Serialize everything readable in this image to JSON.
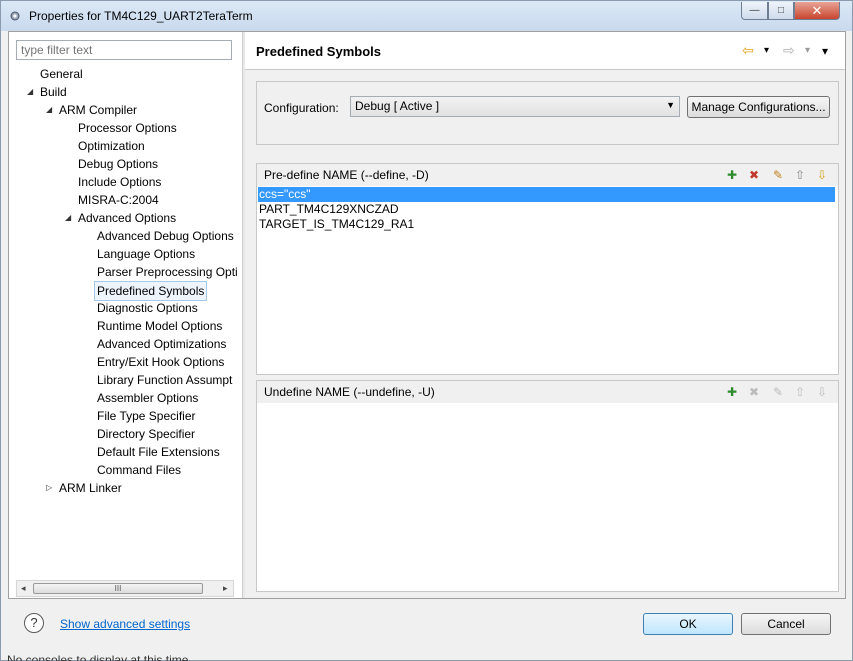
{
  "window": {
    "title": "Properties for TM4C129_UART2TeraTerm",
    "minimize": "—",
    "maximize": "□",
    "close": "✕"
  },
  "filter": {
    "placeholder": "type filter text"
  },
  "tree": [
    {
      "label": "General",
      "depth": 0,
      "twisty": ""
    },
    {
      "label": "Build",
      "depth": 0,
      "twisty": "◢"
    },
    {
      "label": "ARM Compiler",
      "depth": 1,
      "twisty": "◢"
    },
    {
      "label": "Processor Options",
      "depth": 2,
      "twisty": ""
    },
    {
      "label": "Optimization",
      "depth": 2,
      "twisty": ""
    },
    {
      "label": "Debug Options",
      "depth": 2,
      "twisty": ""
    },
    {
      "label": "Include Options",
      "depth": 2,
      "twisty": ""
    },
    {
      "label": "MISRA-C:2004",
      "depth": 2,
      "twisty": ""
    },
    {
      "label": "Advanced Options",
      "depth": 2,
      "twisty": "◢"
    },
    {
      "label": "Advanced Debug Options",
      "depth": 3,
      "twisty": ""
    },
    {
      "label": "Language Options",
      "depth": 3,
      "twisty": ""
    },
    {
      "label": "Parser Preprocessing Opti",
      "depth": 3,
      "twisty": ""
    },
    {
      "label": "Predefined Symbols",
      "depth": 3,
      "twisty": "",
      "selected": true
    },
    {
      "label": "Diagnostic Options",
      "depth": 3,
      "twisty": ""
    },
    {
      "label": "Runtime Model Options",
      "depth": 3,
      "twisty": ""
    },
    {
      "label": "Advanced Optimizations",
      "depth": 3,
      "twisty": ""
    },
    {
      "label": "Entry/Exit Hook Options",
      "depth": 3,
      "twisty": ""
    },
    {
      "label": "Library Function Assumpt",
      "depth": 3,
      "twisty": ""
    },
    {
      "label": "Assembler Options",
      "depth": 3,
      "twisty": ""
    },
    {
      "label": "File Type Specifier",
      "depth": 3,
      "twisty": ""
    },
    {
      "label": "Directory Specifier",
      "depth": 3,
      "twisty": ""
    },
    {
      "label": "Default File Extensions",
      "depth": 3,
      "twisty": ""
    },
    {
      "label": "Command Files",
      "depth": 3,
      "twisty": ""
    },
    {
      "label": "ARM Linker",
      "depth": 1,
      "twisty": "▷"
    }
  ],
  "hscroll": {
    "left": "◂",
    "right": "▸",
    "grip": "III"
  },
  "page": {
    "title": "Predefined Symbols",
    "back": "⇦",
    "forward": "⇨",
    "menu": "▾"
  },
  "config": {
    "label": "Configuration:",
    "value": "Debug  [ Active ]",
    "manage_label": "Manage Configurations..."
  },
  "predefine": {
    "title": "Pre-define NAME (--define, -D)",
    "items": [
      "ccs=\"ccs\"",
      "PART_TM4C129XNCZAD",
      "TARGET_IS_TM4C129_RA1"
    ]
  },
  "undefine": {
    "title": "Undefine NAME (--undefine, -U)",
    "items": []
  },
  "toolbar_icons": [
    "add-icon",
    "delete-icon",
    "edit-icon",
    "move-up-icon",
    "move-down-icon"
  ],
  "bottom": {
    "help": "?",
    "advanced_link": "Show advanced settings",
    "ok": "OK",
    "cancel": "Cancel"
  },
  "background_status": "No consoles to display at this time."
}
